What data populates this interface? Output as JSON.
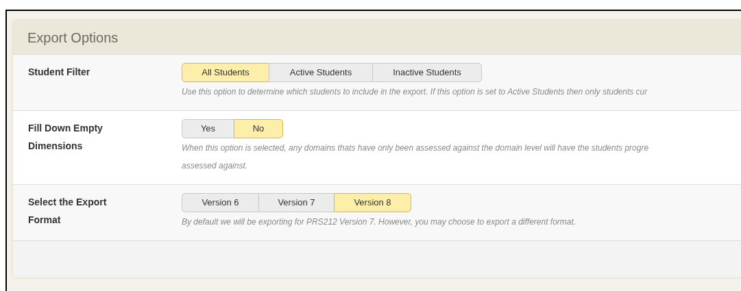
{
  "panel": {
    "title": "Export Options"
  },
  "options": [
    {
      "label": "Student Filter",
      "choices": [
        {
          "label": "All Students",
          "selected": true
        },
        {
          "label": "Active Students",
          "selected": false
        },
        {
          "label": "Inactive Students",
          "selected": false
        }
      ],
      "description": "Use this option to determine which students to include in the export. If this option is set to Active Students then only students cur"
    },
    {
      "label": "Fill Down Empty Dimensions",
      "choices": [
        {
          "label": "Yes",
          "selected": false
        },
        {
          "label": "No",
          "selected": true
        }
      ],
      "description": "When this option is selected, any domains thats have only been assessed against the domain level will have the students progre",
      "description_line_2": "assessed against."
    },
    {
      "label": "Select the Export Format",
      "choices": [
        {
          "label": "Version 6",
          "selected": false
        },
        {
          "label": "Version 7",
          "selected": false
        },
        {
          "label": "Version 8",
          "selected": true
        }
      ],
      "description": "By default we will be exporting for PRS212 Version 7. However, you may choose to export a different format."
    }
  ]
}
